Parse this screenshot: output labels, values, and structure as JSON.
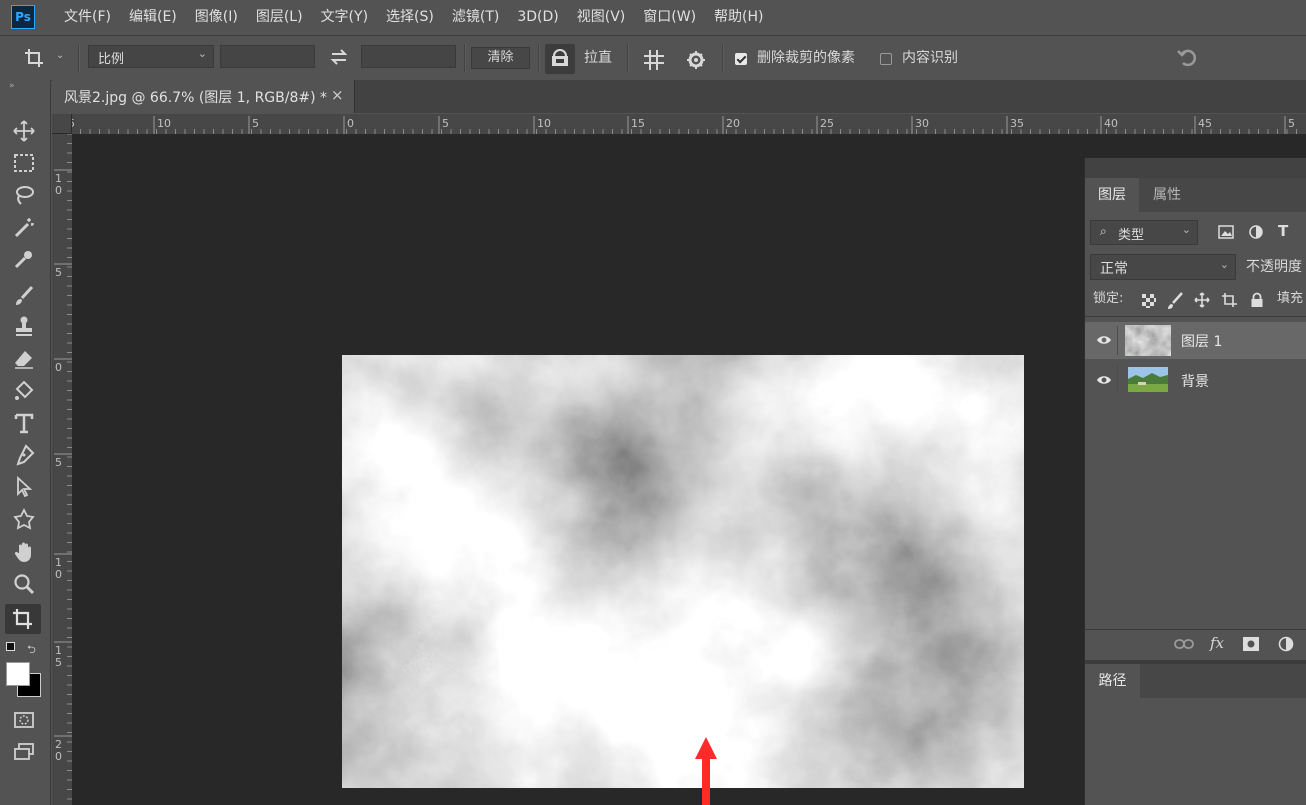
{
  "app": {
    "logo_text": "Ps"
  },
  "menu": [
    "文件(F)",
    "编辑(E)",
    "图像(I)",
    "图层(L)",
    "文字(Y)",
    "选择(S)",
    "滤镜(T)",
    "3D(D)",
    "视图(V)",
    "窗口(W)",
    "帮助(H)"
  ],
  "options": {
    "ratio_select": "比例",
    "clear_label": "清除",
    "straighten_label": "拉直",
    "delete_cropped_label": "删除裁剪的像素",
    "delete_cropped_checked": true,
    "content_aware_label": "内容识别",
    "content_aware_checked": false
  },
  "document_tab": {
    "title": "风景2.jpg @ 66.7% (图层 1, RGB/8#) *",
    "close": "×"
  },
  "ruler_top_labels": [
    "5",
    "10",
    "5",
    "0",
    "5",
    "10",
    "15",
    "20",
    "25",
    "30",
    "35",
    "40",
    "45",
    "5"
  ],
  "ruler_left_labels": [
    "1\n0",
    "5",
    "0",
    "5",
    "1\n0",
    "1\n5",
    "2\n0"
  ],
  "layers_panel": {
    "tabs": [
      "图层",
      "属性"
    ],
    "active_tab": "图层",
    "filter_type": "类型",
    "blend_mode": "正常",
    "opacity_label": "不透明度",
    "lock_label": "锁定:",
    "fill_label": "填充",
    "layers": [
      {
        "name": "图层 1",
        "selected": true,
        "visible": true
      },
      {
        "name": "背景",
        "selected": false,
        "visible": true
      }
    ],
    "footer_icons": [
      "link-icon",
      "fx-icon",
      "mask-icon",
      "adjustment-icon"
    ],
    "fx_label": "fx"
  },
  "paths_panel": {
    "title": "路径"
  },
  "colors": {
    "accent_red": "#ff2b2b",
    "ps_blue": "#31a8ff"
  }
}
